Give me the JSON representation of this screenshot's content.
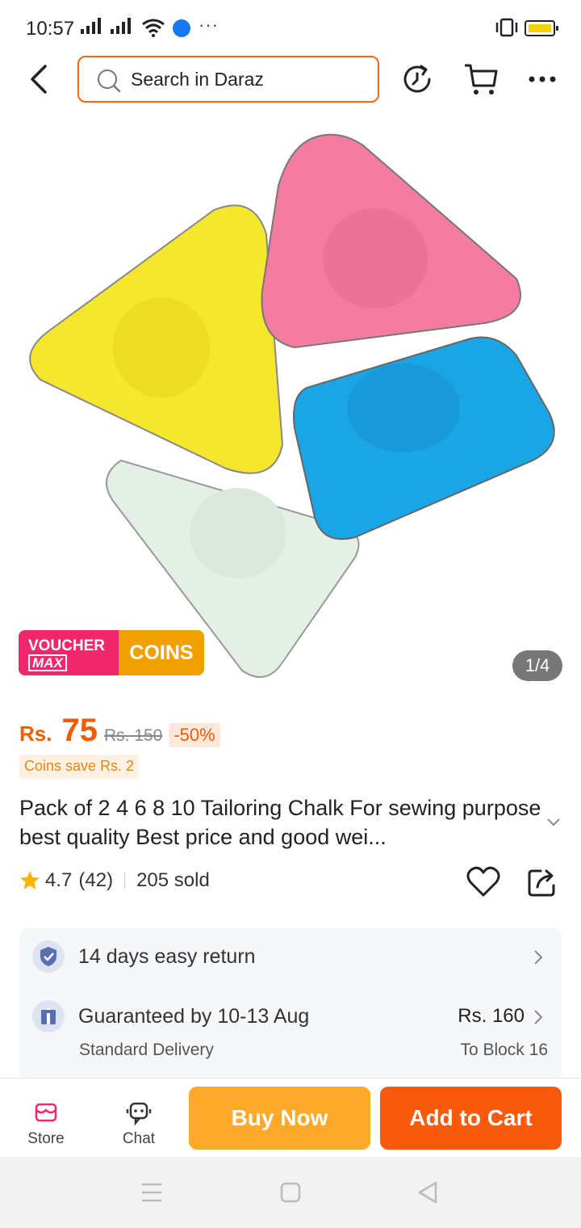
{
  "status_bar": {
    "time": "10:57",
    "icons": [
      "signal-icon",
      "signal-icon",
      "wifi-icon",
      "messenger-icon",
      "more-icon",
      "vibrate-icon",
      "battery-icon"
    ]
  },
  "top_bar": {
    "search_placeholder": "Search in Daraz",
    "icons": [
      "back-icon",
      "search-icon",
      "history-icon",
      "cart-icon",
      "more-icon"
    ]
  },
  "gallery": {
    "badge_voucher": "VOUCHER",
    "badge_max": "MAX",
    "badge_coins": "COINS",
    "counter": "1/4",
    "colors": [
      "#f5e62e",
      "#f47ca0",
      "#1aa6e6",
      "#e4efe6"
    ]
  },
  "price": {
    "currency": "Rs.",
    "value": "75",
    "original": "Rs. 150",
    "discount": "-50%",
    "coins_save": "Coins save Rs. 2"
  },
  "product": {
    "title": "Pack of 2 4 6 8 10 Tailoring Chalk For sewing purpose best quality Best price and good wei...",
    "rating": "4.7",
    "reviews": "(42)",
    "sold": "205 sold"
  },
  "services": {
    "return_text": "14 days easy return",
    "delivery_text": "Guaranteed by 10-13 Aug",
    "delivery_type": "Standard Delivery",
    "delivery_fee": "Rs. 160",
    "delivery_to": "To Block 16"
  },
  "bottom_bar": {
    "store_label": "Store",
    "chat_label": "Chat",
    "buy_label": "Buy Now",
    "cart_label": "Add to Cart"
  },
  "colors": {
    "accent": "#f25c05",
    "buy_now": "#ffa92a",
    "add_to_cart": "#f75a0a",
    "voucher": "#f0276b",
    "coins": "#f0a000"
  }
}
